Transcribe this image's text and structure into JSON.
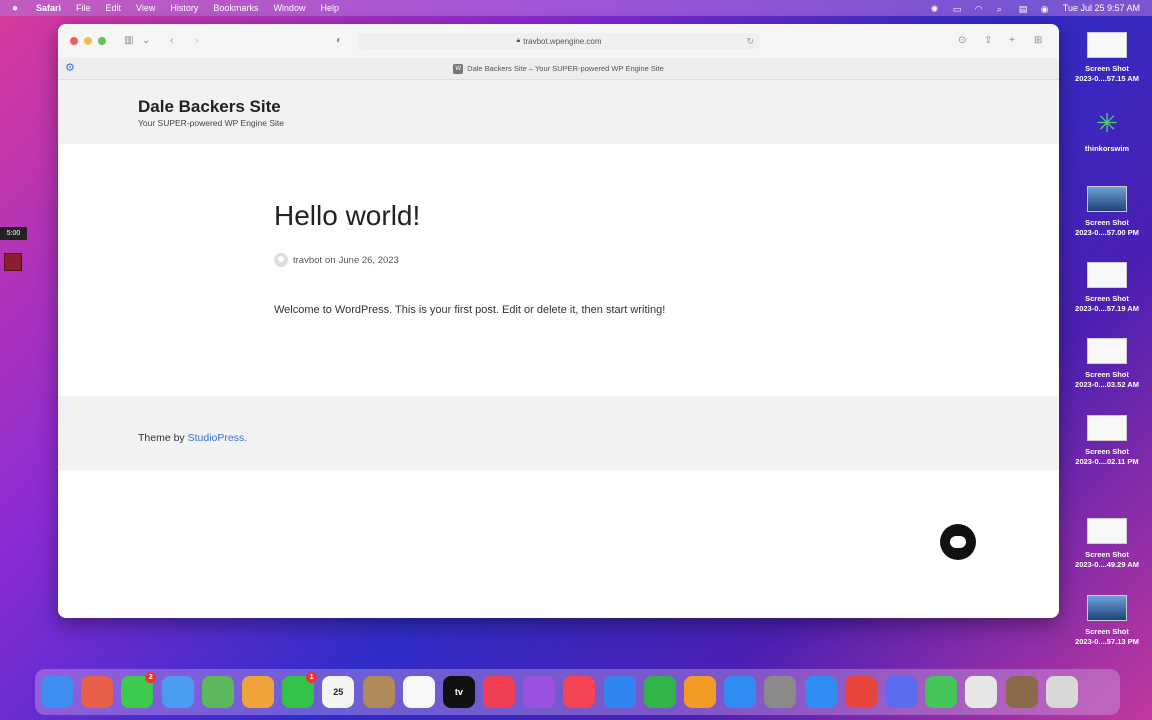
{
  "menubar": {
    "app": "Safari",
    "items": [
      "File",
      "Edit",
      "View",
      "History",
      "Bookmarks",
      "Window",
      "Help"
    ],
    "datetime": "Tue Jul 25  9:57 AM"
  },
  "browser": {
    "url": "travbot.wpengine.com",
    "tab_title": "Dale Backers Site – Your SUPER-powered WP Engine Site",
    "favicon_letter": "W"
  },
  "site": {
    "title": "Dale Backers Site",
    "tagline": "Your SUPER-powered WP Engine Site"
  },
  "post": {
    "title": "Hello world!",
    "author": "travbot",
    "on_label": "on",
    "date": "June 26, 2023",
    "body": "Welcome to WordPress. This is your first post. Edit or delete it, then start writing!"
  },
  "footer": {
    "prefix": "Theme by",
    "link": "StudioPress."
  },
  "timer": "5:00",
  "desktop_icons": [
    {
      "line1": "Screen Shot",
      "line2": "2023-0....57.15 AM",
      "kind": "light"
    },
    {
      "line1": "thinkorswim",
      "line2": "",
      "kind": "tos"
    },
    {
      "line1": "Screen Shot",
      "line2": "2023-0....57.00 PM",
      "kind": "dark"
    },
    {
      "line1": "Screen Shot",
      "line2": "2023-0....57.19 AM",
      "kind": "light"
    },
    {
      "line1": "Screen Shot",
      "line2": "2023-0....03.52 AM",
      "kind": "light"
    },
    {
      "line1": "Screen Shot",
      "line2": "2023-0....02.11 PM",
      "kind": "light"
    },
    {
      "line1": "Screen Shot",
      "line2": "2023-0....49.29 AM",
      "kind": "light"
    },
    {
      "line1": "Screen Shot",
      "line2": "2023-0....57.13 PM",
      "kind": "dark"
    }
  ],
  "dock": {
    "apps": [
      {
        "name": "finder-icon",
        "color": "#3d8ef0",
        "label": ""
      },
      {
        "name": "launchpad-icon",
        "color": "#e8604a",
        "label": ""
      },
      {
        "name": "messages-icon",
        "color": "#3ccb4e",
        "label": "",
        "badge": "2"
      },
      {
        "name": "mail-icon",
        "color": "#4a9cf2",
        "label": ""
      },
      {
        "name": "maps-icon",
        "color": "#5bb85d",
        "label": ""
      },
      {
        "name": "photos-icon",
        "color": "#f0a33b",
        "label": ""
      },
      {
        "name": "facetime-icon",
        "color": "#33c24a",
        "label": "",
        "badge": "1"
      },
      {
        "name": "calendar-icon",
        "color": "#f4f4f4",
        "label": "25"
      },
      {
        "name": "notes-icon",
        "color": "#b08a5a",
        "label": ""
      },
      {
        "name": "reminders-icon",
        "color": "#f7f7f7",
        "label": ""
      },
      {
        "name": "tv-icon",
        "color": "#111111",
        "label": "tv"
      },
      {
        "name": "music-icon",
        "color": "#f13e55",
        "label": ""
      },
      {
        "name": "podcasts-icon",
        "color": "#9b52e0",
        "label": ""
      },
      {
        "name": "news-icon",
        "color": "#f44455",
        "label": ""
      },
      {
        "name": "keynote-icon",
        "color": "#2f86f2",
        "label": ""
      },
      {
        "name": "numbers-icon",
        "color": "#2fb54a",
        "label": ""
      },
      {
        "name": "pages-icon",
        "color": "#f39a24",
        "label": ""
      },
      {
        "name": "appstore-icon",
        "color": "#2e8ef3",
        "label": ""
      },
      {
        "name": "system-preferences-icon",
        "color": "#8a8a8a",
        "label": ""
      },
      {
        "name": "safari-icon",
        "color": "#2e8ef3",
        "label": ""
      },
      {
        "name": "chrome-icon",
        "color": "#e8453c",
        "label": ""
      },
      {
        "name": "settings-flower-icon",
        "color": "#5a6cf0",
        "label": ""
      },
      {
        "name": "chat-app-icon",
        "color": "#45c45a",
        "label": ""
      },
      {
        "name": "document-icon",
        "color": "#e6e6e6",
        "label": ""
      },
      {
        "name": "photo-stack-icon",
        "color": "#8a6a4a",
        "label": ""
      },
      {
        "name": "trash-icon",
        "color": "#d8d8d8",
        "label": ""
      }
    ]
  }
}
